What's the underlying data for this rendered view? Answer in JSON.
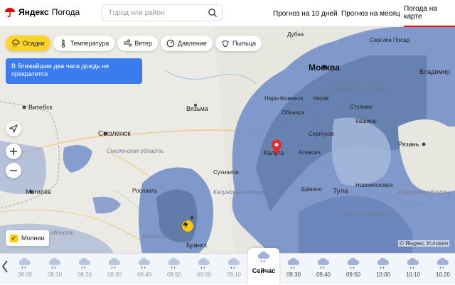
{
  "header": {
    "brand": "Яндекс",
    "product": "Погода",
    "search_placeholder": "Город или район",
    "nav": [
      {
        "label": "Прогноз на 10 дней",
        "active": false
      },
      {
        "label": "Прогноз на месяц",
        "active": false
      },
      {
        "label": "Погода на карте",
        "active": true
      }
    ]
  },
  "layers": [
    {
      "label": "Осадки",
      "icon": "rain-cloud-icon",
      "active": true
    },
    {
      "label": "Температура",
      "icon": "thermometer-icon",
      "active": false
    },
    {
      "label": "Ветер",
      "icon": "wind-icon",
      "active": false
    },
    {
      "label": "Давление",
      "icon": "gauge-icon",
      "active": false
    },
    {
      "label": "Пыльца",
      "icon": "pollen-icon",
      "active": false
    }
  ],
  "forecast_text": "В ближайшие два часа дождь не прекратится",
  "map_labels": {
    "cities": [
      "Москва",
      "Витебск",
      "Смоленск",
      "Вязьма",
      "Калуга",
      "Тула",
      "Рязань",
      "Брянск",
      "Могилёв",
      "Рославль",
      "Обнинск",
      "Серпухов",
      "Кашира",
      "Щёкино",
      "Новомосковск",
      "Алексин",
      "Чехов",
      "Ступино",
      "Наро-Фоминск",
      "Сухиничи"
    ],
    "regions": [
      "Смоленская область",
      "Калужская область",
      "Московская область",
      "Тульская область",
      "Рязанская область",
      "Брянская область",
      "Могилёвская область"
    ],
    "other": [
      "Владимир",
      "Дубна",
      "Сергиев Посад"
    ]
  },
  "lightning_label": "Молнии",
  "copyright": "© Яндекс Условия",
  "timeline": [
    {
      "time": "08:00",
      "kind": "past"
    },
    {
      "time": "08:10",
      "kind": "past"
    },
    {
      "time": "08:20",
      "kind": "past"
    },
    {
      "time": "08:30",
      "kind": "past"
    },
    {
      "time": "08:40",
      "kind": "past"
    },
    {
      "time": "08:50",
      "kind": "past"
    },
    {
      "time": "09:00",
      "kind": "past"
    },
    {
      "time": "09:10",
      "kind": "past"
    },
    {
      "time": "Сейчас",
      "kind": "now"
    },
    {
      "time": "09:30",
      "kind": "future"
    },
    {
      "time": "09:40",
      "kind": "future"
    },
    {
      "time": "09:50",
      "kind": "future"
    },
    {
      "time": "10:00",
      "kind": "future"
    },
    {
      "time": "10:10",
      "kind": "future"
    },
    {
      "time": "10:20",
      "kind": "future"
    }
  ],
  "colors": {
    "accent": "#ffd426",
    "brand_red": "#ff0000",
    "rain": "#6a86bf",
    "banner": "#3a7cf0"
  }
}
